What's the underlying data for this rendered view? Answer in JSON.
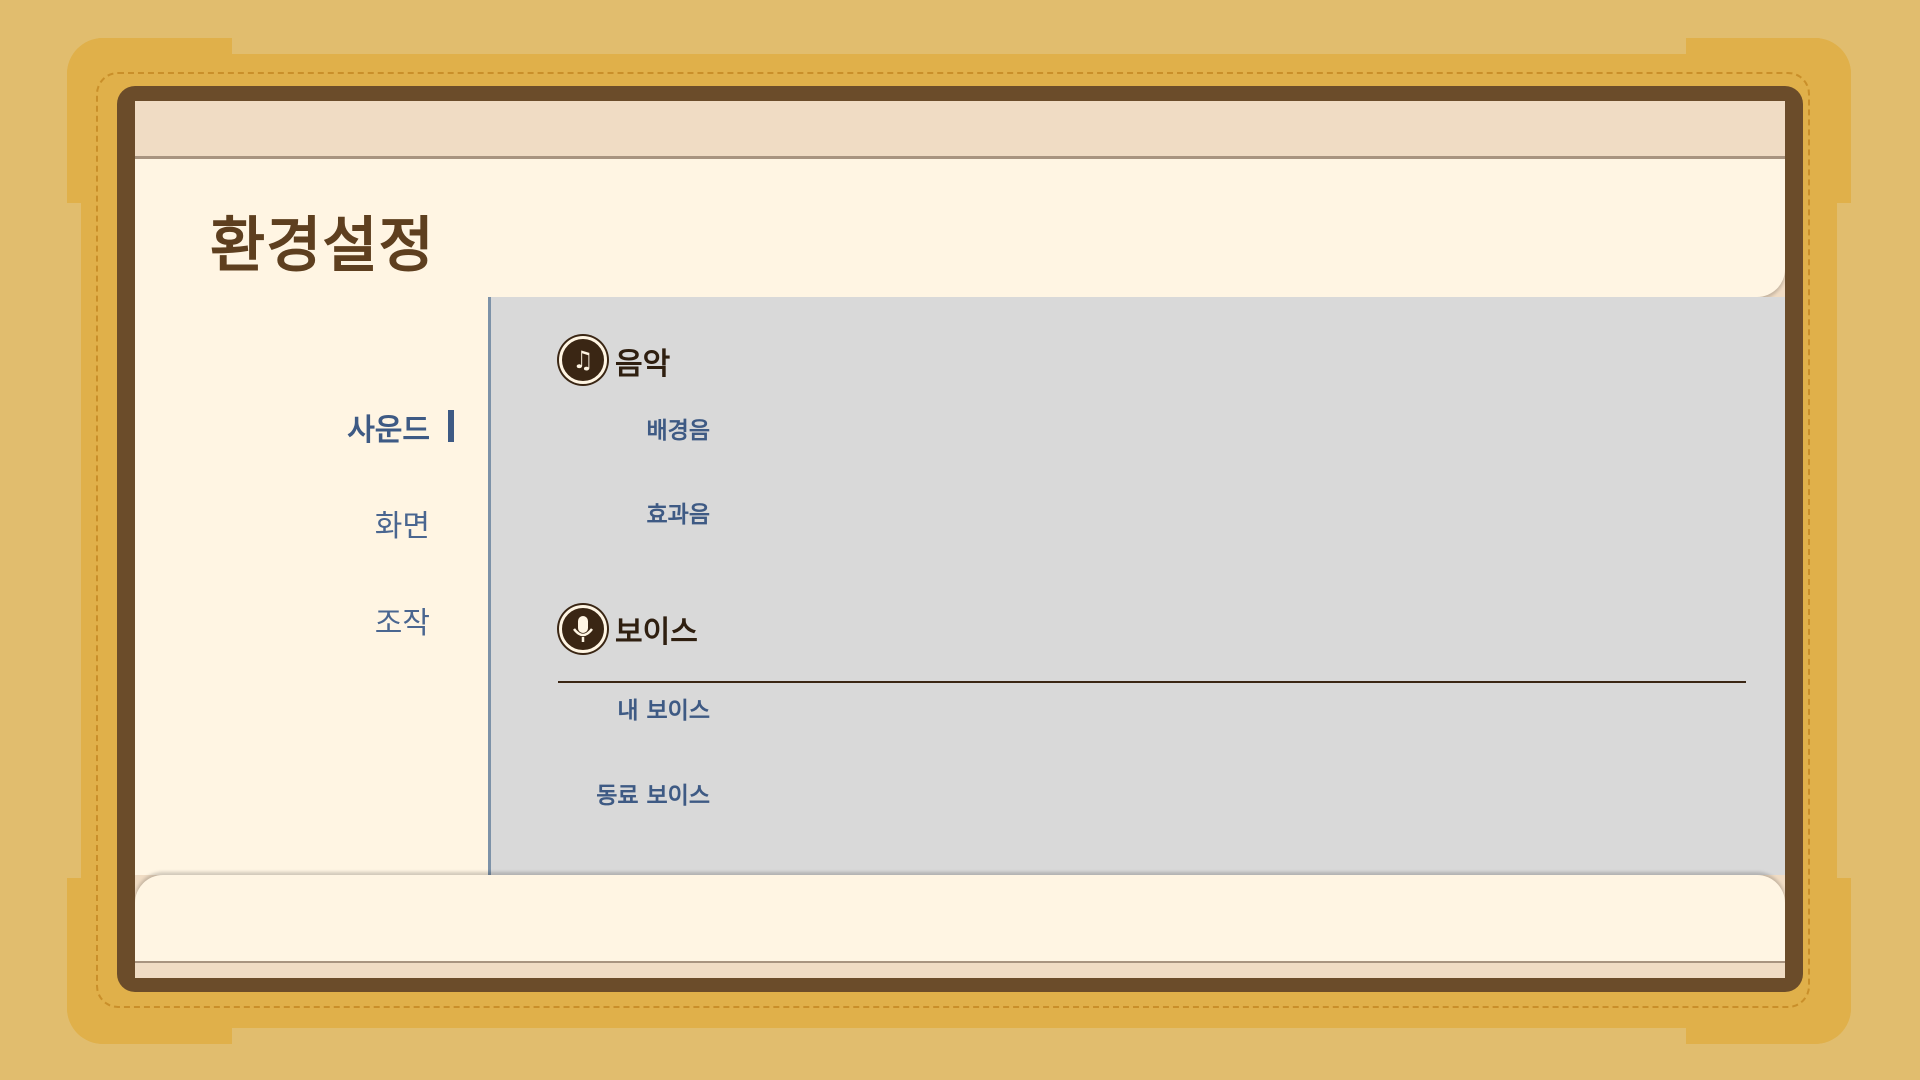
{
  "header": {
    "title": "환경설정"
  },
  "sidebar": {
    "items": [
      {
        "label": "사운드",
        "active": true
      },
      {
        "label": "화면",
        "active": false
      },
      {
        "label": "조작",
        "active": false
      }
    ]
  },
  "sections": {
    "music": {
      "title": "음악",
      "icon": "music-note-icon",
      "items": [
        {
          "label": "배경음"
        },
        {
          "label": "효과음"
        }
      ]
    },
    "voice": {
      "title": "보이스",
      "icon": "microphone-icon",
      "items": [
        {
          "label": "내 보이스"
        },
        {
          "label": "동료 보이스"
        }
      ]
    }
  },
  "colors": {
    "background": "#e1bd6e",
    "frame": "#e0b04a",
    "screen_border": "#6b4c2a",
    "panel": "#fff5e3",
    "content_bg": "#d9d9d9",
    "accent_text": "#3e5a84",
    "title_text": "#5e3f1f"
  }
}
